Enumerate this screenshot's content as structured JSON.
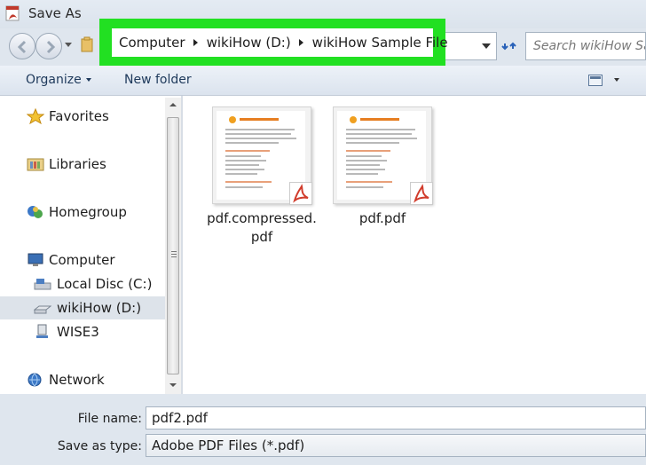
{
  "window": {
    "title": "Save As",
    "app_icon": "adobe-pdf-icon"
  },
  "address": {
    "breadcrumbs": [
      "Computer",
      "wikiHow (D:)",
      "wikiHow Sample File"
    ],
    "search_placeholder": "Search wikiHow Sa...",
    "highlight_color": "#22e022"
  },
  "toolbar": {
    "organize_label": "Organize",
    "new_folder_label": "New folder"
  },
  "nav": {
    "items": [
      {
        "label": "Favorites",
        "icon": "star-icon"
      },
      {
        "label": "Libraries",
        "icon": "library-icon"
      },
      {
        "label": "Homegroup",
        "icon": "homegroup-icon"
      },
      {
        "label": "Computer",
        "icon": "computer-icon"
      },
      {
        "label": "Local Disc (C:)",
        "icon": "drive-icon"
      },
      {
        "label": "wikiHow (D:)",
        "icon": "removable-drive-icon",
        "selected": true
      },
      {
        "label": "WISE3",
        "icon": "network-drive-icon"
      },
      {
        "label": "Network",
        "icon": "network-icon"
      }
    ]
  },
  "files": [
    {
      "name": "pdf.compressed.\npdf",
      "type_icon": "pdf-file-icon"
    },
    {
      "name": "pdf.pdf",
      "type_icon": "pdf-file-icon"
    }
  ],
  "form": {
    "file_name_label": "File name:",
    "file_name_value": "pdf2.pdf",
    "save_type_label": "Save as type:",
    "save_type_value": "Adobe PDF Files (*.pdf)"
  }
}
